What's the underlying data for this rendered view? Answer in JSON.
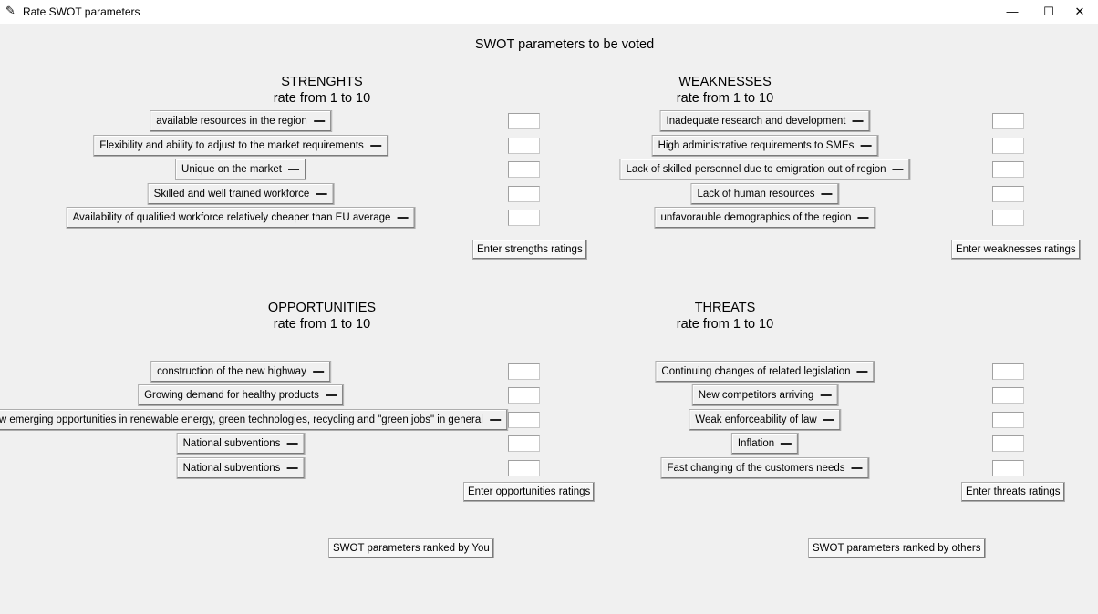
{
  "window": {
    "title": "Rate SWOT parameters",
    "icon": "feather-icon",
    "minimize": "—",
    "maximize": "☐",
    "close": "✕"
  },
  "main_heading": "SWOT parameters to be voted",
  "strengths": {
    "title": "STRENGHTS",
    "subtitle": "rate from 1 to 10",
    "items": [
      "available resources in the region",
      "Flexibility and ability to adjust to the market requirements",
      "Unique on the market",
      "Skilled and well trained workforce",
      "Availability of qualified workforce relatively cheaper than EU average"
    ],
    "button": "Enter strengths ratings"
  },
  "weaknesses": {
    "title": "WEAKNESSES",
    "subtitle": "rate from 1 to 10",
    "items": [
      "Inadequate research and development",
      "High administrative requirements to SMEs",
      "Lack of skilled personnel due to emigration out of region",
      "Lack of human resources",
      "unfavorauble demographics of the region"
    ],
    "button": "Enter weaknesses ratings"
  },
  "opportunities": {
    "title": "OPPORTUNITIES",
    "subtitle": "rate from 1 to 10",
    "items": [
      "construction of the new highway",
      "Growing demand for healthy products",
      "New emerging opportunities in renewable energy, green technologies, recycling and \"green jobs\" in general",
      "National subventions",
      "National subventions"
    ],
    "button": "Enter opportunities ratings"
  },
  "threats": {
    "title": "THREATS",
    "subtitle": "rate from 1 to 10",
    "items": [
      "Continuing changes of related legislation",
      "New competitors arriving",
      "Weak enforceability of law",
      "Inflation",
      "Fast changing of the customers needs"
    ],
    "button": "Enter threats ratings"
  },
  "footer": {
    "ranked_by_you": "SWOT parameters ranked by You",
    "ranked_by_others": "SWOT parameters ranked by others"
  }
}
